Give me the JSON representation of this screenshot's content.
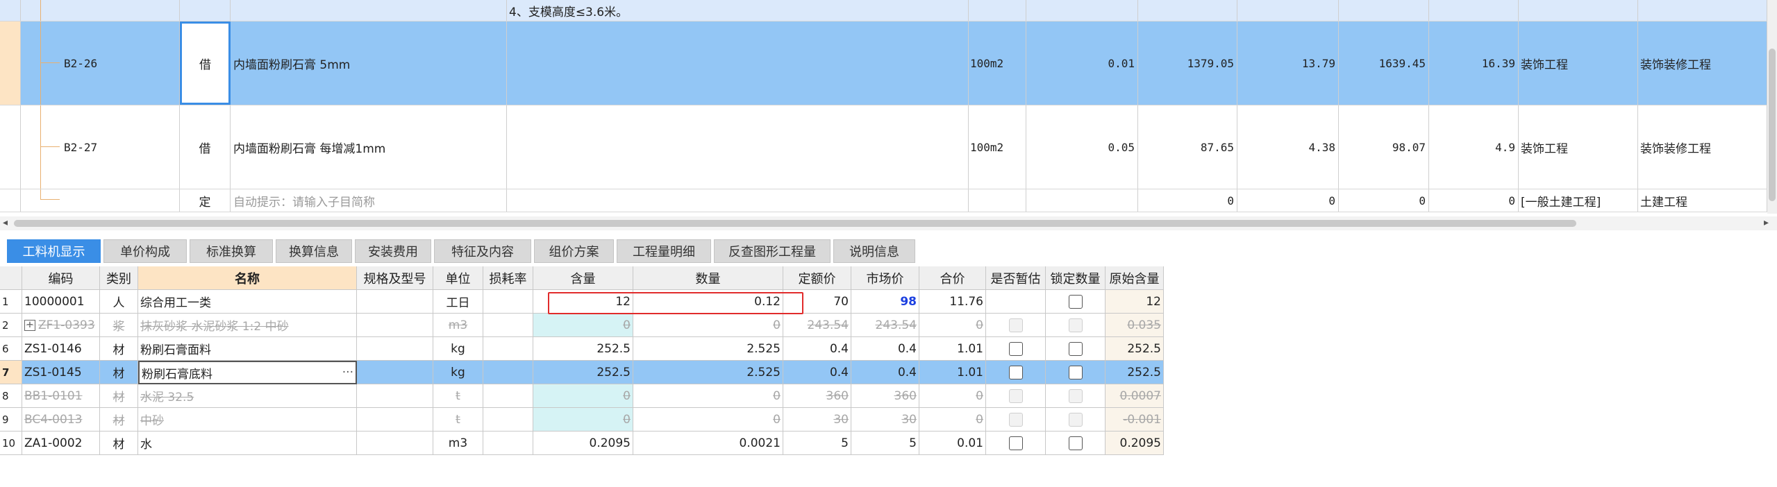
{
  "top_table": {
    "partial_row": {
      "text": "4、支模高度≤3.6米。"
    },
    "rows": [
      {
        "code": "B2-26",
        "kind": "借",
        "name": "内墙面粉刷石膏 5mm",
        "unit": "100m2",
        "qty": "0.01",
        "price": "1379.05",
        "total": "13.79",
        "price2": "1639.45",
        "total2": "16.39",
        "category": "装饰工程",
        "major": "装饰装修工程"
      },
      {
        "code": "B2-27",
        "kind": "借",
        "name": "内墙面粉刷石膏 每增减1mm",
        "unit": "100m2",
        "qty": "0.05",
        "price": "87.65",
        "total": "4.38",
        "price2": "98.07",
        "total2": "4.9",
        "category": "装饰工程",
        "major": "装饰装修工程"
      },
      {
        "code": "",
        "kind": "定",
        "name": "自动提示：请输入子目简称",
        "unit": "",
        "qty": "",
        "price": "0",
        "total": "0",
        "price2": "0",
        "total2": "0",
        "category": "[一般土建工程]",
        "major": "土建工程"
      }
    ]
  },
  "tabs": [
    "工料机显示",
    "单价构成",
    "标准换算",
    "换算信息",
    "安装费用",
    "特征及内容",
    "组价方案",
    "工程量明细",
    "反查图形工程量",
    "说明信息"
  ],
  "grid": {
    "headers": [
      "编码",
      "类别",
      "名称",
      "规格及型号",
      "单位",
      "损耗率",
      "含量",
      "数量",
      "定额价",
      "市场价",
      "合价",
      "是否暂估",
      "锁定数量",
      "原始含量"
    ],
    "rows": [
      {
        "idx": "1",
        "code": "10000001",
        "type": "人",
        "name": "综合用工一类",
        "spec": "",
        "unit": "工日",
        "loss": "",
        "content": "12",
        "qty": "0.12",
        "base": "70",
        "market": "98",
        "sum": "11.76",
        "orig": "12"
      },
      {
        "idx": "2",
        "code": "ZF1-0393",
        "type": "浆",
        "name": "抹灰砂浆 水泥砂浆 1:2 中砂",
        "spec": "",
        "unit": "m3",
        "loss": "",
        "content": "0",
        "qty": "0",
        "base": "243.54",
        "market": "243.54",
        "sum": "0",
        "orig": "0.035"
      },
      {
        "idx": "6",
        "code": "ZS1-0146",
        "type": "材",
        "name": "粉刷石膏面料",
        "spec": "",
        "unit": "kg",
        "loss": "",
        "content": "252.5",
        "qty": "2.525",
        "base": "0.4",
        "market": "0.4",
        "sum": "1.01",
        "orig": "252.5"
      },
      {
        "idx": "7",
        "code": "ZS1-0145",
        "type": "材",
        "name": "粉刷石膏底料",
        "spec": "",
        "unit": "kg",
        "loss": "",
        "content": "252.5",
        "qty": "2.525",
        "base": "0.4",
        "market": "0.4",
        "sum": "1.01",
        "orig": "252.5",
        "ellipsis": "···"
      },
      {
        "idx": "8",
        "code": "BB1-0101",
        "type": "材",
        "name": "水泥 32.5",
        "spec": "",
        "unit": "t",
        "loss": "",
        "content": "0",
        "qty": "0",
        "base": "360",
        "market": "360",
        "sum": "0",
        "orig": "0.0007"
      },
      {
        "idx": "9",
        "code": "BC4-0013",
        "type": "材",
        "name": "中砂",
        "spec": "",
        "unit": "t",
        "loss": "",
        "content": "0",
        "qty": "0",
        "base": "30",
        "market": "30",
        "sum": "0",
        "orig": "-0.001"
      },
      {
        "idx": "10",
        "code": "ZA1-0002",
        "type": "材",
        "name": "水",
        "spec": "",
        "unit": "m3",
        "loss": "",
        "content": "0.2095",
        "qty": "0.0021",
        "base": "5",
        "market": "5",
        "sum": "0.01",
        "orig": "0.2095"
      }
    ]
  }
}
